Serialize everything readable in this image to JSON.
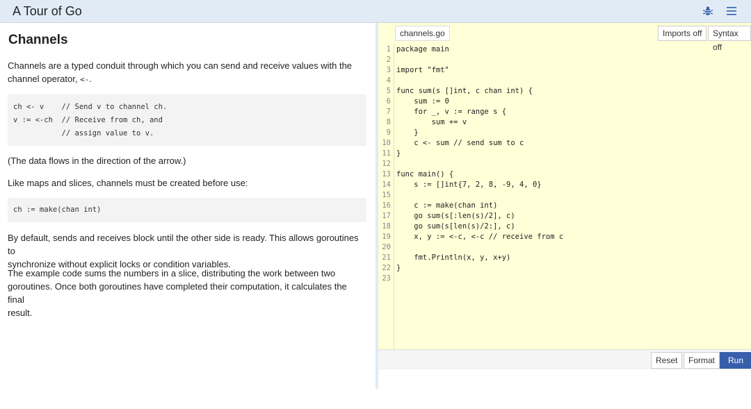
{
  "header": {
    "title": "A Tour of Go",
    "icons": [
      "bug-icon",
      "menu-icon"
    ]
  },
  "lesson": {
    "heading": "Channels",
    "p1": "Channels are a typed conduit through which you can send and receive values with the",
    "p1b": "channel operator, ",
    "p1_op": "<-",
    "p1_end": ".",
    "code1": [
      "ch <- v    // Send v to channel ch.",
      "v := <-ch  // Receive from ch, and",
      "           // assign value to v."
    ],
    "p2": "(The data flows in the direction of the arrow.)",
    "p3": "Like maps and slices, channels must be created before use:",
    "code2": "ch := make(chan int)",
    "p4a": "By default, sends and receives block until the other side is ready. This allows goroutines to",
    "p4b": "synchronize without explicit locks or condition variables.",
    "p5a": "The example code sums the numbers in a slice, distributing the work between two",
    "p5b": "goroutines. Once both goroutines have completed their computation, it calculates the final",
    "p5c": "result."
  },
  "editor": {
    "file_tab": "channels.go",
    "imports_label": "Imports off",
    "syntax_label": "Syntax off",
    "lines": [
      "package main",
      "",
      "import \"fmt\"",
      "",
      "func sum(s []int, c chan int) {",
      "    sum := 0",
      "    for _, v := range s {",
      "        sum += v",
      "    }",
      "    c <- sum // send sum to c",
      "}",
      "",
      "func main() {",
      "    s := []int{7, 2, 8, -9, 4, 0}",
      "",
      "    c := make(chan int)",
      "    go sum(s[:len(s)/2], c)",
      "    go sum(s[len(s)/2:], c)",
      "    x, y := <-c, <-c // receive from c",
      "",
      "    fmt.Println(x, y, x+y)",
      "}",
      ""
    ]
  },
  "output": {
    "reset_label": "Reset",
    "format_label": "Format",
    "run_label": "Run"
  },
  "colors": {
    "accent": "#375eab",
    "editor_bg": "#ffffd8",
    "header_bg": "#e0ebf5"
  }
}
